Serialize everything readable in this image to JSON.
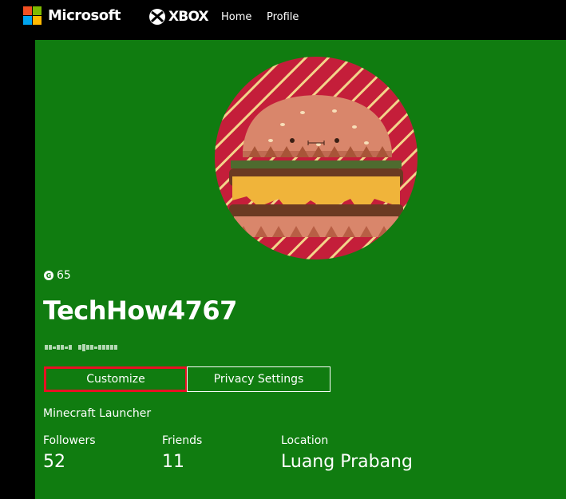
{
  "header": {
    "brand": "Microsoft",
    "xbox_label": "XBOX",
    "nav": [
      {
        "label": "Home"
      },
      {
        "label": "Profile"
      }
    ]
  },
  "profile": {
    "gamerscore": "65",
    "gamerscore_icon": "G",
    "gamertag": "TechHow4767",
    "avatar": "burger-gamerpic",
    "buttons": {
      "customize": "Customize",
      "privacy": "Privacy Settings"
    },
    "presence": "Minecraft Launcher",
    "stats": [
      {
        "label": "Followers",
        "value": "52"
      },
      {
        "label": "Friends",
        "value": "11"
      },
      {
        "label": "Location",
        "value": "Luang Prabang"
      }
    ]
  },
  "colors": {
    "xbox_green": "#107c10",
    "highlight_red": "#e81123",
    "avatar_red": "#c41e3a"
  }
}
